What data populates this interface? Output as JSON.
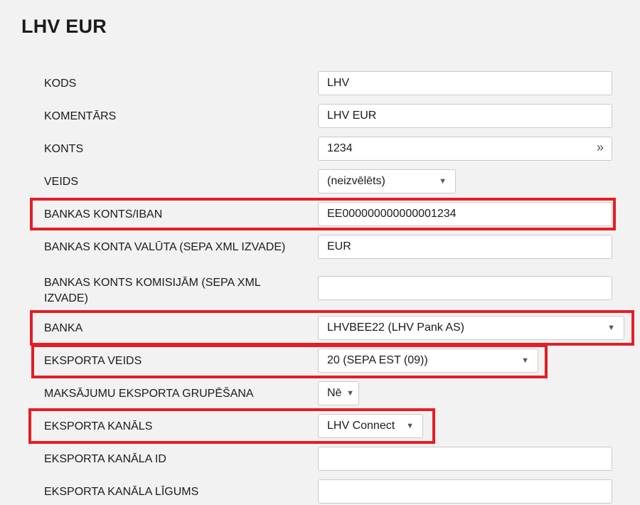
{
  "page": {
    "title": "LHV EUR"
  },
  "fields": {
    "kods": {
      "label": "KODS",
      "value": "LHV"
    },
    "komentars": {
      "label": "KOMENTĀRS",
      "value": "LHV EUR"
    },
    "konts": {
      "label": "KONTS",
      "value": "1234",
      "icon": "double-chevron-right-icon"
    },
    "veids": {
      "label": "VEIDS",
      "value": "(neizvēlēts)"
    },
    "bankas_konts": {
      "label": "BANKAS KONTS/IBAN",
      "value": "EE000000000000001234"
    },
    "konta_valuta": {
      "label": "BANKAS KONTA VALŪTA (SEPA XML IZVADE)",
      "value": "EUR"
    },
    "konts_komisijam": {
      "label": "BANKAS KONTS KOMISIJĀM (SEPA XML IZVADE)",
      "value": ""
    },
    "banka": {
      "label": "BANKA",
      "value": "LHVBEE22 (LHV Pank AS)"
    },
    "eksporta_veids": {
      "label": "EKSPORTA VEIDS",
      "value": "20 (SEPA EST (09))"
    },
    "grupesana": {
      "label": "MAKSĀJUMU EKSPORTA GRUPĒŠANA",
      "value": "Nē"
    },
    "eksporta_kanals": {
      "label": "EKSPORTA KANĀLS",
      "value": "LHV Connect"
    },
    "kanala_id": {
      "label": "EKSPORTA KANĀLA ID",
      "value": ""
    },
    "kanala_ligums": {
      "label": "EKSPORTA KANĀLA LĪGUMS",
      "value": ""
    }
  },
  "colors": {
    "highlight": "#e41e26",
    "background": "#f2f2f2"
  }
}
